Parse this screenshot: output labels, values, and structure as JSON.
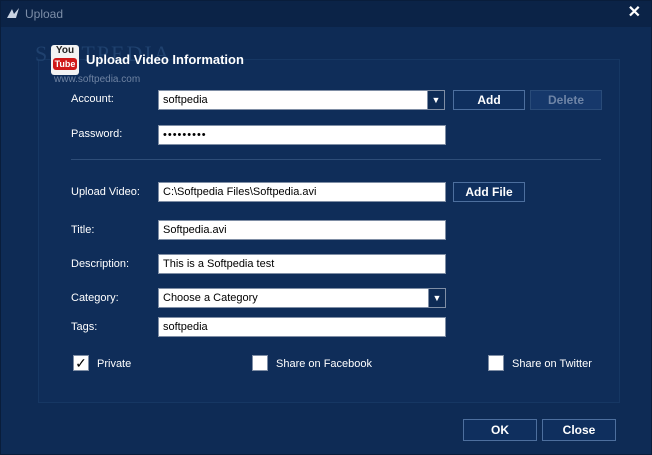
{
  "window": {
    "title": "Upload",
    "close_glyph": "✕",
    "icon": "app-icon"
  },
  "branding": {
    "watermark": "SOFTPEDIA",
    "watermark_url": "www.softpedia.com",
    "yt_you": "You",
    "yt_tube": "Tube"
  },
  "header": {
    "title": "Upload Video Information"
  },
  "account": {
    "label": "Account:",
    "value": "softpedia",
    "add_label": "Add",
    "delete_label": "Delete"
  },
  "password": {
    "label": "Password:",
    "value": "•••••••••"
  },
  "upload_video": {
    "label": "Upload Video:",
    "value": "C:\\Softpedia Files\\Softpedia.avi",
    "add_file_label": "Add File"
  },
  "title_field": {
    "label": "Title:",
    "value": "Softpedia.avi"
  },
  "description": {
    "label": "Description:",
    "value": "This is a Softpedia test"
  },
  "category": {
    "label": "Category:",
    "value": "Choose a Category"
  },
  "tags": {
    "label": "Tags:",
    "value": "softpedia"
  },
  "options": {
    "private_label": "Private",
    "private_checked": "✓",
    "facebook_label": "Share on Facebook",
    "twitter_label": "Share on Twitter"
  },
  "footer": {
    "ok_label": "OK",
    "close_label": "Close"
  }
}
